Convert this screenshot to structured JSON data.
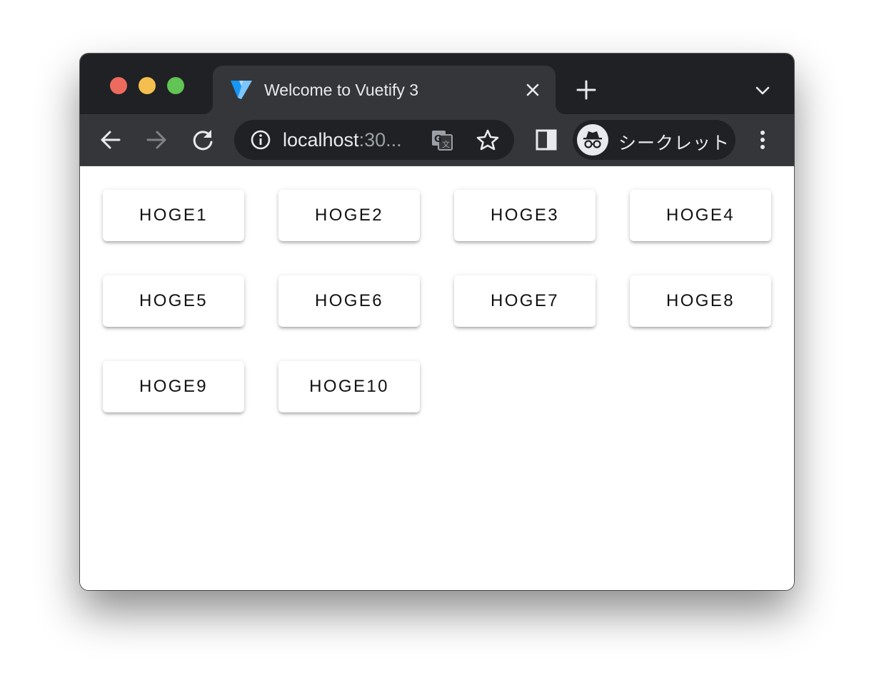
{
  "browser": {
    "tab": {
      "title": "Welcome to Vuetify 3"
    },
    "address_bar": {
      "host": "localhost",
      "port_truncated": ":30..."
    },
    "profile": {
      "label": "シークレット"
    },
    "icons": {
      "favicon": "vuetify-logo-icon",
      "close": "close-icon",
      "new_tab": "plus-icon",
      "tab_search": "chevron-down-icon",
      "back": "arrow-left-icon",
      "forward": "arrow-right-icon",
      "reload": "reload-icon",
      "site_info": "info-icon",
      "translate": "translate-icon",
      "bookmark": "star-icon",
      "side_panel": "side-panel-icon",
      "incognito": "incognito-icon",
      "menu": "kebab-menu-icon"
    },
    "colors": {
      "titlebar": "#202124",
      "toolbar": "#35363a",
      "traffic_red": "#ed6a5e",
      "traffic_yellow": "#f5bf4f",
      "traffic_green": "#61c454"
    }
  },
  "page": {
    "buttons": [
      {
        "label": "HOGE1"
      },
      {
        "label": "HOGE2"
      },
      {
        "label": "HOGE3"
      },
      {
        "label": "HOGE4"
      },
      {
        "label": "HOGE5"
      },
      {
        "label": "HOGE6"
      },
      {
        "label": "HOGE7"
      },
      {
        "label": "HOGE8"
      },
      {
        "label": "HOGE9"
      },
      {
        "label": "HOGE10"
      }
    ]
  }
}
